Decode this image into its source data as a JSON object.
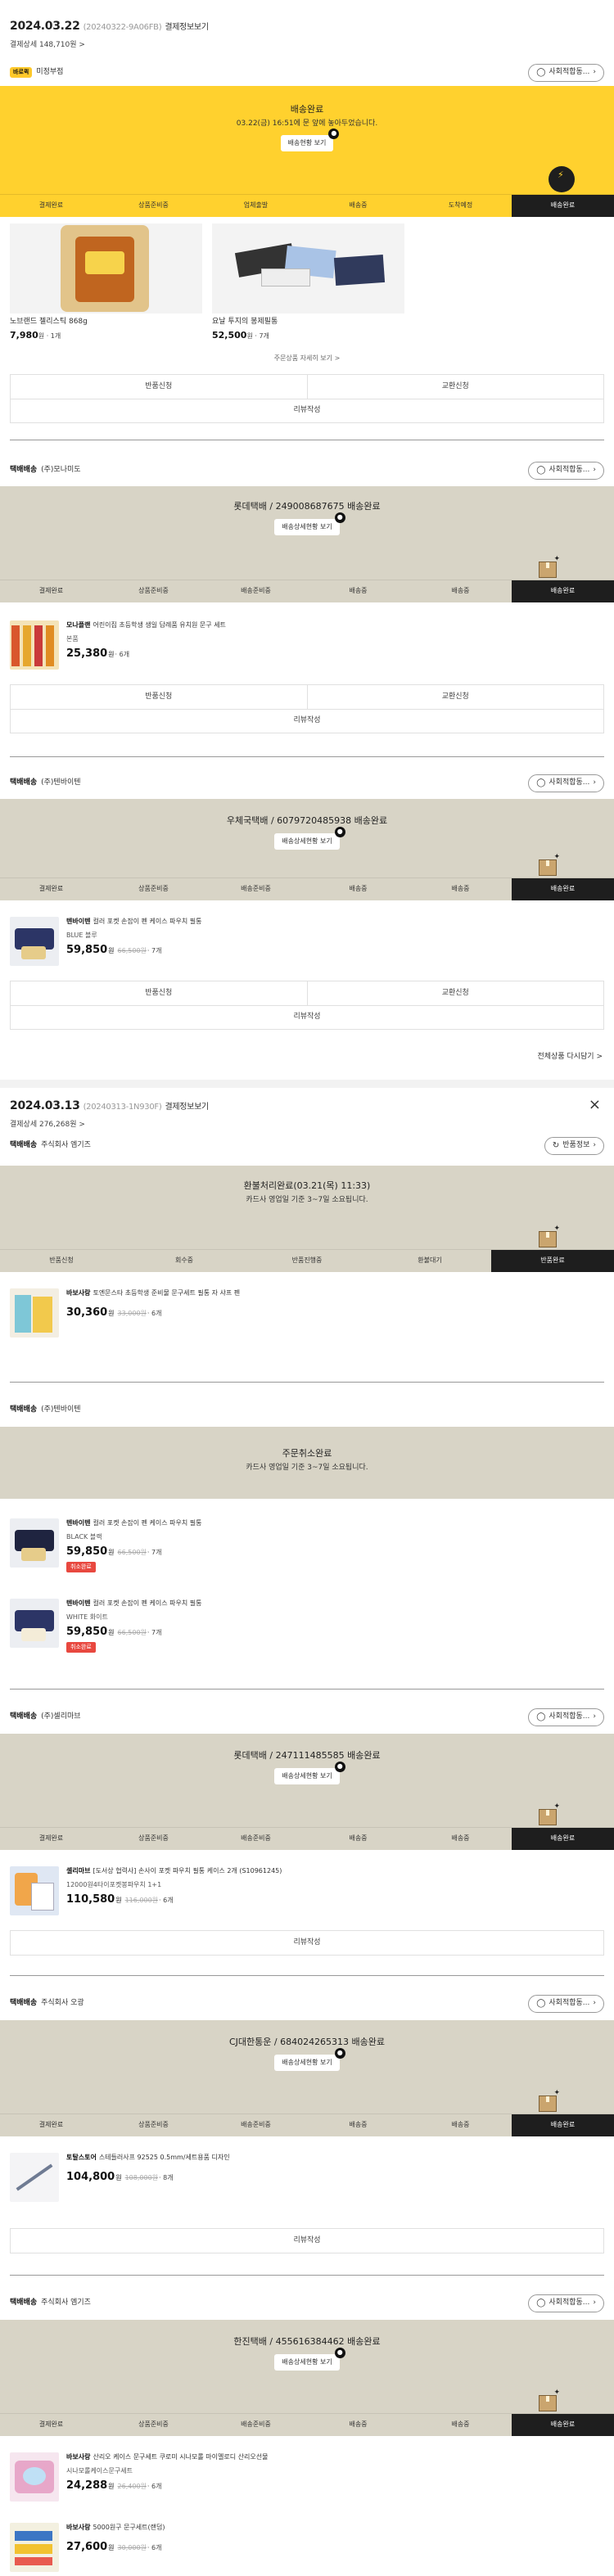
{
  "orders": [
    {
      "date": "2024.03.22",
      "order_no": "(20240322-9A06FB)",
      "link": "결제정보보기",
      "pay_summary": "결제상세 148,710원 >"
    },
    {
      "date": "2024.03.13",
      "order_no": "(20240313-1N930F)",
      "link": "결제정보보기",
      "pay_summary": "결제상세 276,268원 >"
    }
  ],
  "close_icon": "×",
  "s1": {
    "badge": "바로퀵",
    "seller": "미정부점",
    "button": "사회적합동...",
    "status": "배송완료",
    "sub": "03.22(금) 16:51에 문 앞에 놓아두었습니다.",
    "track": "배송현황 보기",
    "steps": [
      "결제완료",
      "상품준비중",
      "업체출발",
      "배송중",
      "도착예정",
      "배송완료"
    ],
    "items": [
      {
        "name": "노브랜드 젤리스틱 868g",
        "price": "7,980",
        "unit": "원 · 1개"
      },
      {
        "name": "요날 투지의 봉제필통",
        "price": "52,500",
        "unit": "원 · 7개"
      }
    ],
    "more": "주문상품 자세히 보기 >",
    "buttons": [
      "반품신청",
      "교환신청",
      "리뷰작성"
    ]
  },
  "s2": {
    "type": "택배배송",
    "seller": "(주)모나미도",
    "button": "사회적합동...",
    "status": "롯데택배 / 249008687675 배송완료",
    "track": "배송상세현황 보기",
    "steps": [
      "결제완료",
      "상품준비중",
      "배송준비중",
      "배송중",
      "배송중",
      "배송완료"
    ],
    "product": {
      "brand": "모나플랜",
      "name": "어린이집 초등학생 생일 답례품 유치원 문구 세트",
      "option": "본품",
      "price": "25,380",
      "won": "원",
      "orig": "",
      "qty": "· 6개"
    },
    "buttons": [
      "반품신청",
      "교환신청",
      "리뷰작성"
    ]
  },
  "s3": {
    "type": "택배배송",
    "seller": "(주)텐바이텐",
    "button": "사회적합동...",
    "status": "우체국택배 / 6079720485938 배송완료",
    "track": "배송상세현황 보기",
    "steps": [
      "결제완료",
      "상품준비중",
      "배송준비중",
      "배송중",
      "배송중",
      "배송완료"
    ],
    "product": {
      "brand": "텐바이텐",
      "name": "컬러 포켓 손잡이 펜 케이스 파우치 필통",
      "option": "BLUE 블루",
      "price": "59,850",
      "won": "원",
      "orig": "66,500원",
      "qty": "· 7개"
    },
    "buttons": [
      "반품신청",
      "교환신청",
      "리뷰작성"
    ],
    "more": "전체상품 다시담기 >"
  },
  "s4": {
    "type": "택배배송",
    "seller": "주식회사 엠기즈",
    "button": "반품정보",
    "status": "환불처리완료(03.21(목) 11:33)",
    "sub": "카드사 영업일 기준 3~7일 소요됩니다.",
    "steps": [
      "반품신청",
      "회수중",
      "반품진행중",
      "환불대기",
      "반품완료"
    ],
    "product": {
      "brand": "바보사랑",
      "name": "토엔문스타 초등학생 준비물 문구세트 필통 자 샤프 펜",
      "option": "",
      "price": "30,360",
      "won": "원",
      "orig": "33,000원",
      "qty": "· 6개"
    }
  },
  "s5": {
    "type": "택배배송",
    "seller": "(주)텐바이텐",
    "status": "주문취소완료",
    "sub": "카드사 영업일 기준 3~7일 소요됩니다.",
    "products": [
      {
        "brand": "텐바이텐",
        "name": "컬러 포켓 손잡이 펜 케이스 파우치 필통",
        "option": "BLACK 블랙",
        "price": "59,850",
        "won": "원",
        "orig": "66,500원",
        "qty": "· 7개",
        "tag": "취소완료"
      },
      {
        "brand": "텐바이텐",
        "name": "컬러 포켓 손잡이 펜 케이스 파우치 필통",
        "option": "WHITE 화이트",
        "price": "59,850",
        "won": "원",
        "orig": "66,500원",
        "qty": "· 7개",
        "tag": "취소완료"
      }
    ]
  },
  "s6": {
    "type": "택배배송",
    "seller": "(주)셀리마브",
    "button": "사회적합동...",
    "status": "롯데택배 / 247111485585 배송완료",
    "track": "배송상세현황 보기",
    "steps": [
      "결제완료",
      "상품준비중",
      "배송준비중",
      "배송중",
      "배송중",
      "배송완료"
    ],
    "product": {
      "brand": "셀리마브",
      "name": "[도서상 협력사] 손사이 포켓 파우치 필통 케이스 2개 (S10961245)",
      "option": "12000원4타이포켓봉파우치 1+1",
      "price": "110,580",
      "won": "원",
      "orig": "116,000원",
      "qty": "· 6개"
    },
    "buttons": [
      "리뷰작성"
    ]
  },
  "s7": {
    "type": "택배배송",
    "seller": "주식회사 오광",
    "button": "사회적합동...",
    "status": "CJ대한통운 / 684024265313 배송완료",
    "track": "배송상세현황 보기",
    "steps": [
      "결제완료",
      "상품준비중",
      "배송준비중",
      "배송중",
      "배송중",
      "배송완료"
    ],
    "product": {
      "brand": "토탈스토어",
      "name": "스테들러사프 92525 0.5mm/세트용품 디자인",
      "option": "",
      "price": "104,800",
      "won": "원",
      "orig": "108,000원",
      "qty": "· 8개"
    },
    "buttons": [
      "리뷰작성"
    ]
  },
  "s8": {
    "type": "택배배송",
    "seller": "주식회사 엠기즈",
    "button": "사회적합동...",
    "status": "한진택배 / 455616384462 배송완료",
    "track": "배송상세현황 보기",
    "steps": [
      "결제완료",
      "상품준비중",
      "배송준비중",
      "배송중",
      "배송중",
      "배송완료"
    ],
    "products": [
      {
        "brand": "바보사랑",
        "name": "산리오 케이스 문구세트 쿠로미 시나모롤 마이멜로디 산리오선물",
        "option": "시나모롤케이스문구세트",
        "price": "24,288",
        "won": "원",
        "orig": "26,400원",
        "qty": "· 6개"
      },
      {
        "brand": "바보사랑",
        "name": "5000원구 문구세트(랜덤)",
        "option": "",
        "price": "27,600",
        "won": "원",
        "orig": "30,000원",
        "qty": "· 6개"
      }
    ]
  },
  "colors": {
    "yellow": "#ffd12e",
    "beige": "#d8d4c6",
    "active": "#1e1e1e",
    "red": "#e8483f"
  }
}
